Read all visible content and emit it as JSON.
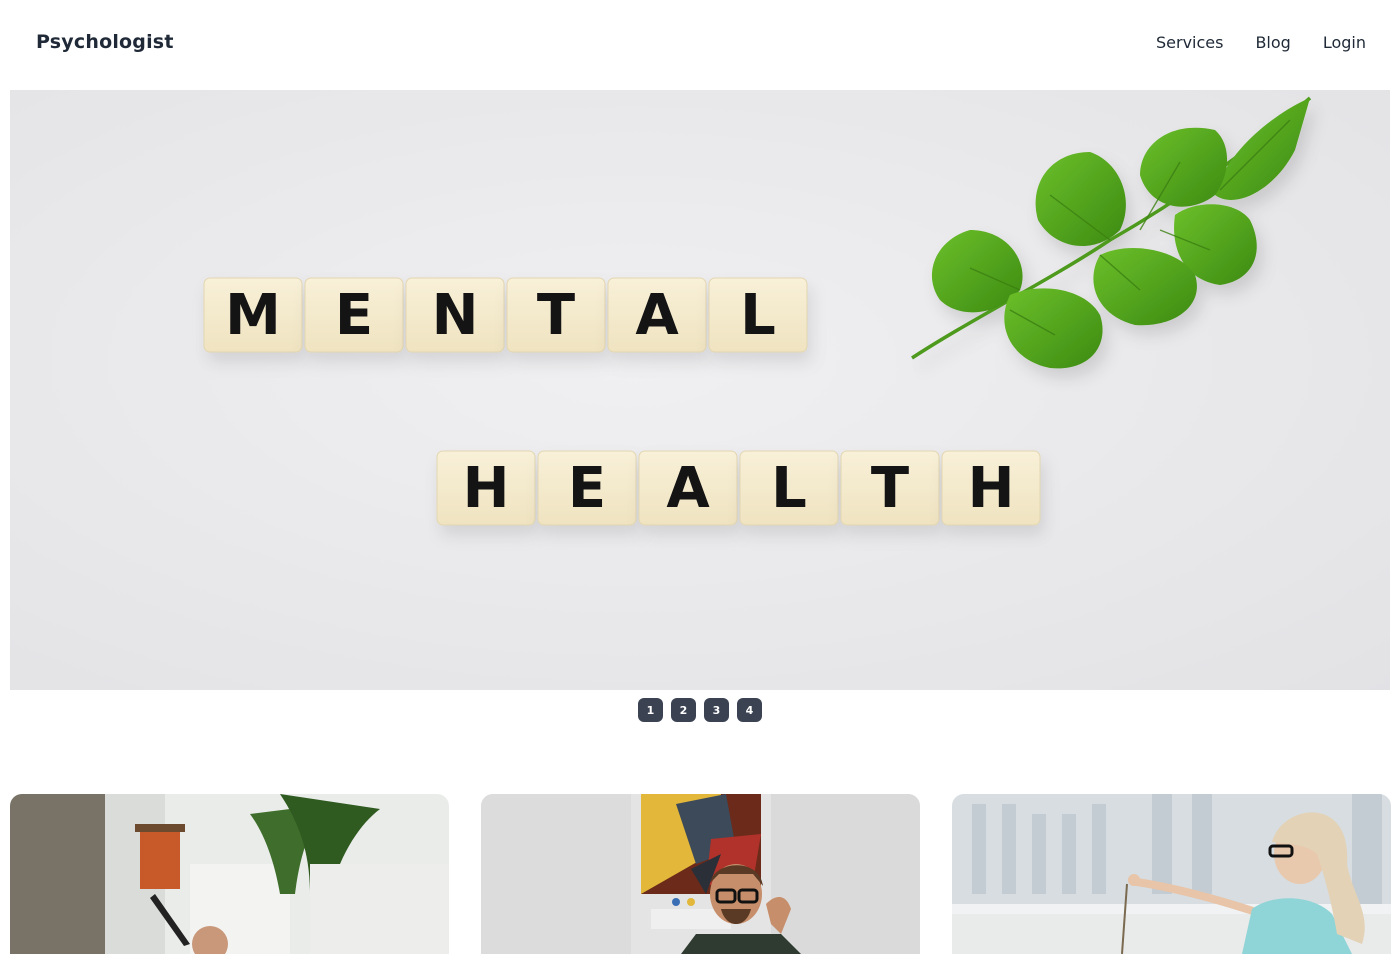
{
  "nav": {
    "brand": "Psychologist",
    "links": [
      {
        "label": "Services"
      },
      {
        "label": "Blog"
      },
      {
        "label": "Login"
      }
    ]
  },
  "hero": {
    "image": "mental-health-scrabble-tiles-with-leaf-photo",
    "tiles_line1": [
      "M",
      "E",
      "N",
      "T",
      "A",
      "L"
    ],
    "tiles_line2": [
      "H",
      "E",
      "A",
      "L",
      "T",
      "H"
    ]
  },
  "carousel": {
    "dots": [
      "1",
      "2",
      "3",
      "4"
    ]
  },
  "cards": [
    {
      "image": "therapist-writing-notes-photo"
    },
    {
      "image": "man-with-glasses-thinking-photo"
    },
    {
      "image": "woman-with-glasses-therapy-photo"
    }
  ],
  "colors": {
    "text": "#1f2937",
    "dot_bg": "#3b4252",
    "leaf": "#4a9a1a",
    "tile": "#f5ecd0"
  }
}
